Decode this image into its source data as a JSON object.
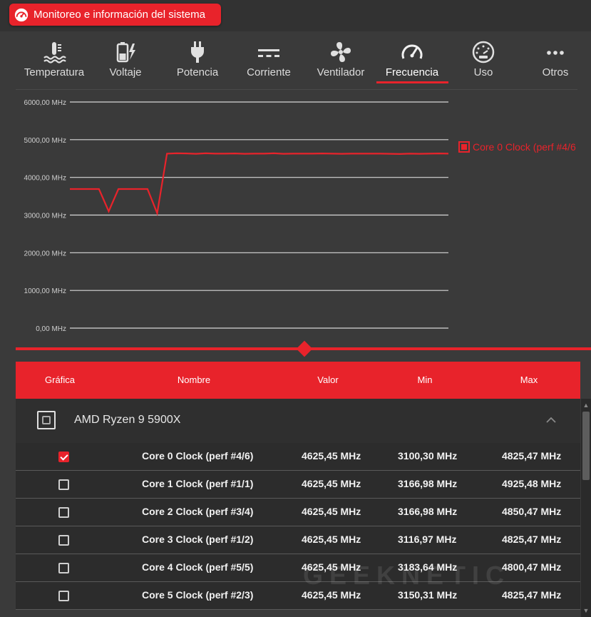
{
  "app": {
    "title": "Monitoreo e información del sistema",
    "icon": "gauge-icon"
  },
  "tabs": [
    {
      "label": "Temperatura",
      "icon": "thermometer-water-icon"
    },
    {
      "label": "Voltaje",
      "icon": "battery-bolt-icon"
    },
    {
      "label": "Potencia",
      "icon": "plug-icon"
    },
    {
      "label": "Corriente",
      "icon": "dc-current-icon"
    },
    {
      "label": "Ventilador",
      "icon": "fan-icon"
    },
    {
      "label": "Frecuencia",
      "icon": "speedometer-icon",
      "active": true
    },
    {
      "label": "Uso",
      "icon": "usage-gauge-icon"
    },
    {
      "label": "Otros",
      "icon": "more-dots-icon"
    }
  ],
  "colors": {
    "accent": "#e8232b",
    "background": "#3a3a3a",
    "row": "#2c2c2c"
  },
  "chart_data": {
    "type": "line",
    "yticks": [
      "6000,00 MHz",
      "5000,00 MHz",
      "4000,00 MHz",
      "3000,00 MHz",
      "2000,00 MHz",
      "1000,00 MHz",
      "0,00 MHz"
    ],
    "ylim": [
      0,
      6000
    ],
    "grid": true,
    "legend_position": "right",
    "series": [
      {
        "name": "Core 0 Clock (perf #4/6",
        "color": "#e8232b",
        "values": [
          3690,
          3690,
          3690,
          3690,
          3100,
          3690,
          3690,
          3690,
          3690,
          3050,
          4630,
          4640,
          4635,
          4625,
          4640,
          4630,
          4630,
          4635,
          4625,
          4630,
          4630,
          4640,
          4625,
          4630,
          4630,
          4630,
          4635,
          4630,
          4625,
          4630,
          4630,
          4630,
          4630,
          4625,
          4620,
          4630,
          4625,
          4630,
          4635,
          4630
        ]
      }
    ]
  },
  "table": {
    "headers": [
      "Gráfica",
      "Nombre",
      "Valor",
      "Min",
      "Max"
    ],
    "group": {
      "name": "AMD Ryzen 9 5900X",
      "expand_icon": "chevron-up-icon"
    },
    "rows": [
      {
        "checked": true,
        "name": "Core 0 Clock (perf #4/6)",
        "value": "4625,45 MHz",
        "min": "3100,30 MHz",
        "max": "4825,47 MHz"
      },
      {
        "checked": false,
        "name": "Core 1 Clock (perf #1/1)",
        "value": "4625,45 MHz",
        "min": "3166,98 MHz",
        "max": "4925,48 MHz"
      },
      {
        "checked": false,
        "name": "Core 2 Clock (perf #3/4)",
        "value": "4625,45 MHz",
        "min": "3166,98 MHz",
        "max": "4850,47 MHz"
      },
      {
        "checked": false,
        "name": "Core 3 Clock (perf #1/2)",
        "value": "4625,45 MHz",
        "min": "3116,97 MHz",
        "max": "4825,47 MHz"
      },
      {
        "checked": false,
        "name": "Core 4 Clock (perf #5/5)",
        "value": "4625,45 MHz",
        "min": "3183,64 MHz",
        "max": "4800,47 MHz"
      },
      {
        "checked": false,
        "name": "Core 5 Clock (perf #2/3)",
        "value": "4625,45 MHz",
        "min": "3150,31 MHz",
        "max": "4825,47 MHz"
      }
    ]
  },
  "watermark": "GEEKNETIC"
}
